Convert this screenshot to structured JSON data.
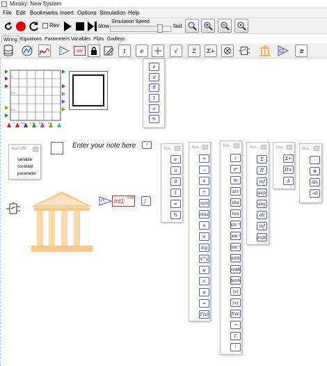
{
  "window": {
    "title": "Minsky: New System"
  },
  "menu": [
    "File",
    "Edit",
    "Bookmarks",
    "Insert",
    "Options",
    "Simulation",
    "Help"
  ],
  "toolbar": {
    "rev_label": "Rev",
    "slow_label": "slow",
    "speed_label": "Simulation Speed",
    "fast_label": "fast",
    "speed_value": 0.75
  },
  "tabs": [
    "Wiring",
    "Equations",
    "Parameters",
    "Variables",
    "Plots",
    "Godleys"
  ],
  "icons": {
    "var_label": "var",
    "time_label": "t",
    "e_label": "e",
    "sqrt_label": "√",
    "sum_label": "Σ",
    "sum_plus_label": "Σ+",
    "sheet_label": "≣"
  },
  "canvas": {
    "plot_ticks_y": [
      "1",
      "0.8",
      "0.8"
    ],
    "plot_ticks_x": [
      "1",
      "0.8",
      "0.8",
      "0.8",
      "0.8"
    ],
    "note_label": "Enter your note here",
    "note_badge": "!",
    "tearoff_title": "tearoff8",
    "tearoff_items": [
      "variable",
      "constant",
      "parameter"
    ],
    "integral_label": "int1",
    "integral_value": "0.00",
    "integral_prefix": "∫dt"
  },
  "popups": {
    "constants_top": [
      "e",
      "π",
      "0",
      "1",
      "∞",
      "%"
    ],
    "tea_header": "tea...",
    "tea1": [
      "e",
      "π",
      "0",
      "1",
      "∞",
      "%"
    ],
    "tea2": [
      "+",
      "−",
      "×",
      "÷",
      "min",
      "max",
      "∧",
      "∨",
      "log",
      "x^y",
      "ψ",
      "<",
      "≤",
      "=",
      "Γ(x)"
    ],
    "tea3": [
      "√",
      "eˣ",
      "ln",
      "sin",
      "cos",
      "tan",
      "sin⁻¹",
      "cos⁻¹",
      "tan⁻¹",
      "sinh",
      "cosh",
      "tanh",
      "|x|",
      "⌊x⌋",
      "frac",
      "¬",
      "Γ",
      "!"
    ],
    "tea4": [
      "Σ",
      "Π",
      "inf",
      "sup",
      "any",
      "all",
      "inf",
      "supi"
    ],
    "tea5": [
      "Σ+",
      "Π×",
      "Δ"
    ],
    "tea6": [
      "·",
      "⊗",
      "idx",
      "≺ll"
    ]
  },
  "colors": {
    "record_red": "#e00000",
    "accent_blue": "#4a5ab0",
    "bank_orange": "#f7c98d"
  }
}
